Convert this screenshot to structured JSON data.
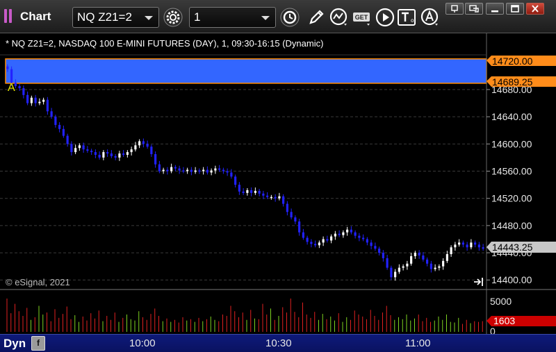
{
  "window": {
    "title": "Chart",
    "symbol_field": "NQ Z21=2",
    "interval_field": "1"
  },
  "toolbar": {
    "buttons": [
      "gear-icon",
      "clock-icon",
      "pencil-icon",
      "indicator-icon",
      "get-icon",
      "play-icon",
      "text-icon",
      "alert-icon"
    ]
  },
  "chart_header": "* NQ Z21=2, NASDAQ 100 E-MINI FUTURES (DAY), 1, 09:30-16:15 (Dynamic)",
  "watermark": "© eSignal, 2021",
  "annotation_letter": "A",
  "price_axis": {
    "ticks": [
      "14400.00",
      "14440.00",
      "14480.00",
      "14520.00",
      "14560.00",
      "14600.00",
      "14640.00",
      "14680.00"
    ],
    "highlight_high": "14720.00",
    "highlight_low": "14689.25",
    "last_price": "14443.25"
  },
  "volume_axis": {
    "top": "5000",
    "zero": "0",
    "last": "1603"
  },
  "time_axis": {
    "mode": "Dyn",
    "button": "f",
    "labels": [
      "10:00",
      "10:30",
      "11:00"
    ]
  },
  "colors": {
    "up": "#ffffff",
    "down": "#2222ff",
    "band": "#3366ff",
    "band_border": "#ff8c00",
    "label_orange": "#ff8c1a",
    "label_grey": "#c8c8c8",
    "volume_up": "#7ed321",
    "volume_down": "#e02020",
    "volume_badge": "#cc0000"
  },
  "chart_data": {
    "type": "candlestick",
    "y_range": [
      14388,
      14730
    ],
    "closes": [
      14710,
      14690,
      14685,
      14682,
      14672,
      14660,
      14668,
      14660,
      14662,
      14665,
      14648,
      14640,
      14628,
      14622,
      14612,
      14600,
      14588,
      14594,
      14598,
      14592,
      14590,
      14588,
      14584,
      14580,
      14588,
      14586,
      14582,
      14580,
      14586,
      14584,
      14588,
      14592,
      14598,
      14604,
      14600,
      14596,
      14585,
      14570,
      14560,
      14562,
      14560,
      14566,
      14564,
      14561,
      14560,
      14562,
      14559,
      14561,
      14560,
      14562,
      14558,
      14561,
      14564,
      14562,
      14560,
      14558,
      14552,
      14540,
      14530,
      14528,
      14532,
      14528,
      14531,
      14527,
      14524,
      14522,
      14522,
      14520,
      14523,
      14512,
      14500,
      14492,
      14486,
      14470,
      14462,
      14456,
      14453,
      14451,
      14455,
      14460,
      14458,
      14464,
      14468,
      14466,
      14470,
      14474,
      14470,
      14465,
      14462,
      14460,
      14455,
      14450,
      14446,
      14440,
      14432,
      14418,
      14404,
      14412,
      14418,
      14420,
      14424,
      14435,
      14440,
      14436,
      14430,
      14424,
      14416,
      14418,
      14420,
      14428,
      14438,
      14448,
      14452,
      14455,
      14452,
      14448,
      14455,
      14452,
      14448,
      14446
    ]
  },
  "volume_data": {
    "max": 5000,
    "values": [
      5800,
      2800,
      4200,
      3100,
      2400,
      3600,
      1800,
      2200,
      3900,
      2600,
      2900,
      1600,
      3400,
      2100,
      2700,
      3800,
      1900,
      2500,
      1500,
      2300,
      1700,
      2800,
      2000,
      3200,
      1600,
      2400,
      1800,
      2900,
      1500,
      2100,
      2600,
      1900,
      1700,
      3100,
      2200,
      1800,
      2700,
      3500,
      2400,
      1600,
      2000,
      1500,
      1800,
      1400,
      2200,
      1700,
      1900,
      1500,
      2100,
      1600,
      1900,
      2300,
      1800,
      1600,
      2600,
      2400,
      3900,
      3100,
      2200,
      2900,
      1800,
      3300,
      2000,
      1900,
      4200,
      2600,
      3500,
      1800,
      2400,
      3700,
      2900,
      5300,
      3000,
      2200,
      4400,
      2600,
      2100,
      3000,
      1800,
      2700,
      1900,
      2300,
      1700,
      2800,
      1500,
      2200,
      1800,
      3200,
      2600,
      2300,
      1900,
      3300,
      2400,
      1800,
      2900,
      3900,
      2500,
      1800,
      2200,
      1900,
      2600,
      1700,
      2000,
      2600,
      1600,
      2100,
      1500,
      1700,
      2300,
      1800,
      2600,
      1500,
      1400,
      2100,
      1200,
      1800,
      1300,
      1600,
      1500,
      1603
    ]
  }
}
